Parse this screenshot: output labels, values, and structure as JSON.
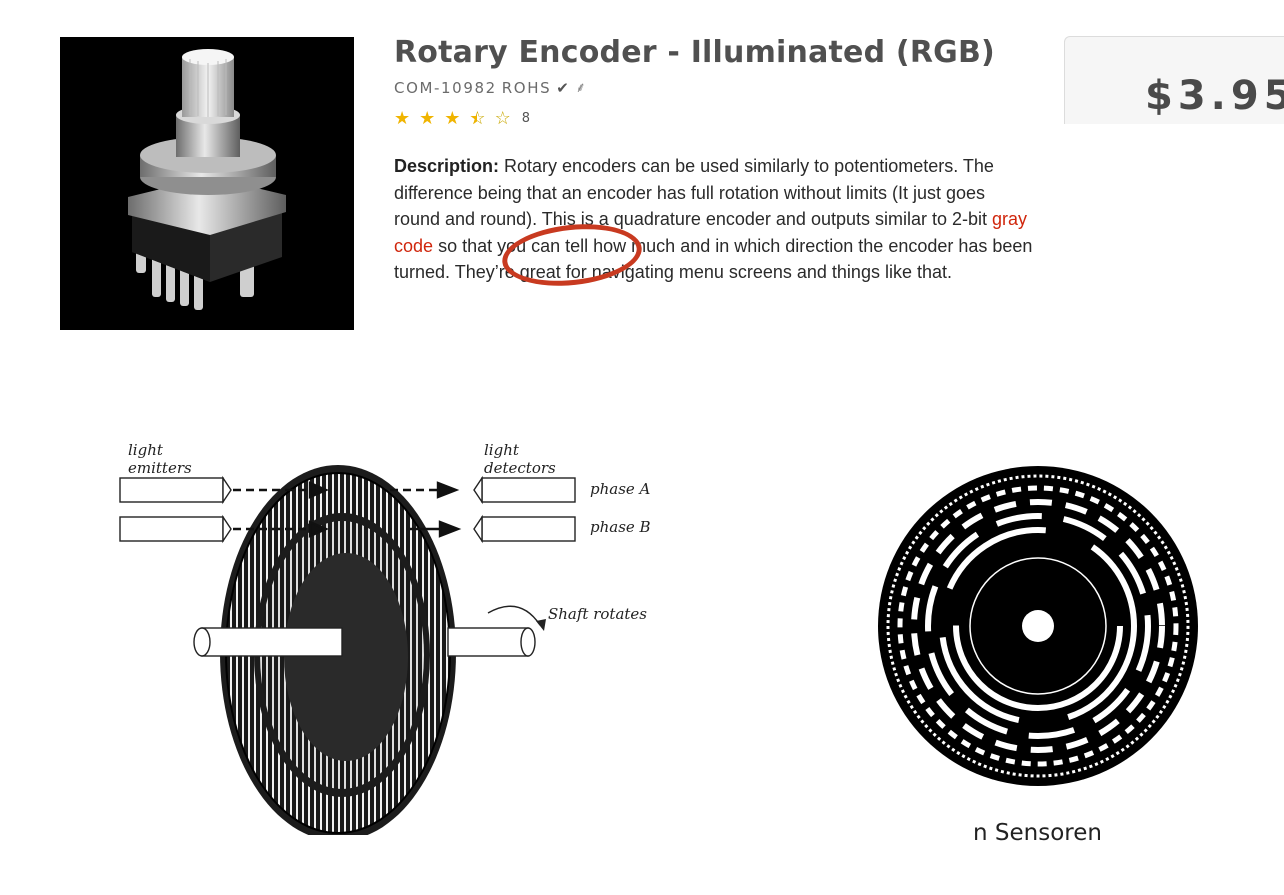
{
  "product": {
    "title": "Rotary Encoder - Illuminated (RGB)",
    "sku": "COM-10982",
    "rohs": "ROHS",
    "check_icon": "check-icon",
    "leaf_icon": "leaf-icon",
    "rating_value": 3.5,
    "rating_max": 5,
    "review_count": "8",
    "price": "$3.95"
  },
  "description": {
    "label": "Description:",
    "text_before_link": "Rotary encoders can be used similarly to potentiometers. The difference being that an encoder has full rotation without limits (It just goes round and round). This is a quadrature encoder and outputs similar to 2-bit",
    "link_text": "gray code",
    "text_after_link": "so that you can tell how much and in which direction the encoder has been turned. They’re great for navigating menu screens and things like that."
  },
  "diagram_left": {
    "label_emitters_line1": "light",
    "label_emitters_line2": "emitters",
    "label_detectors_line1": "light",
    "label_detectors_line2": "detectors",
    "label_phase_a": "phase A",
    "label_phase_b": "phase B",
    "label_shaft": "Shaft rotates"
  },
  "diagram_right": {
    "caption": "n Sensoren"
  },
  "colors": {
    "title": "#505050",
    "link": "#d0260c",
    "annotation": "#c83a20",
    "star": "#f0b400"
  }
}
